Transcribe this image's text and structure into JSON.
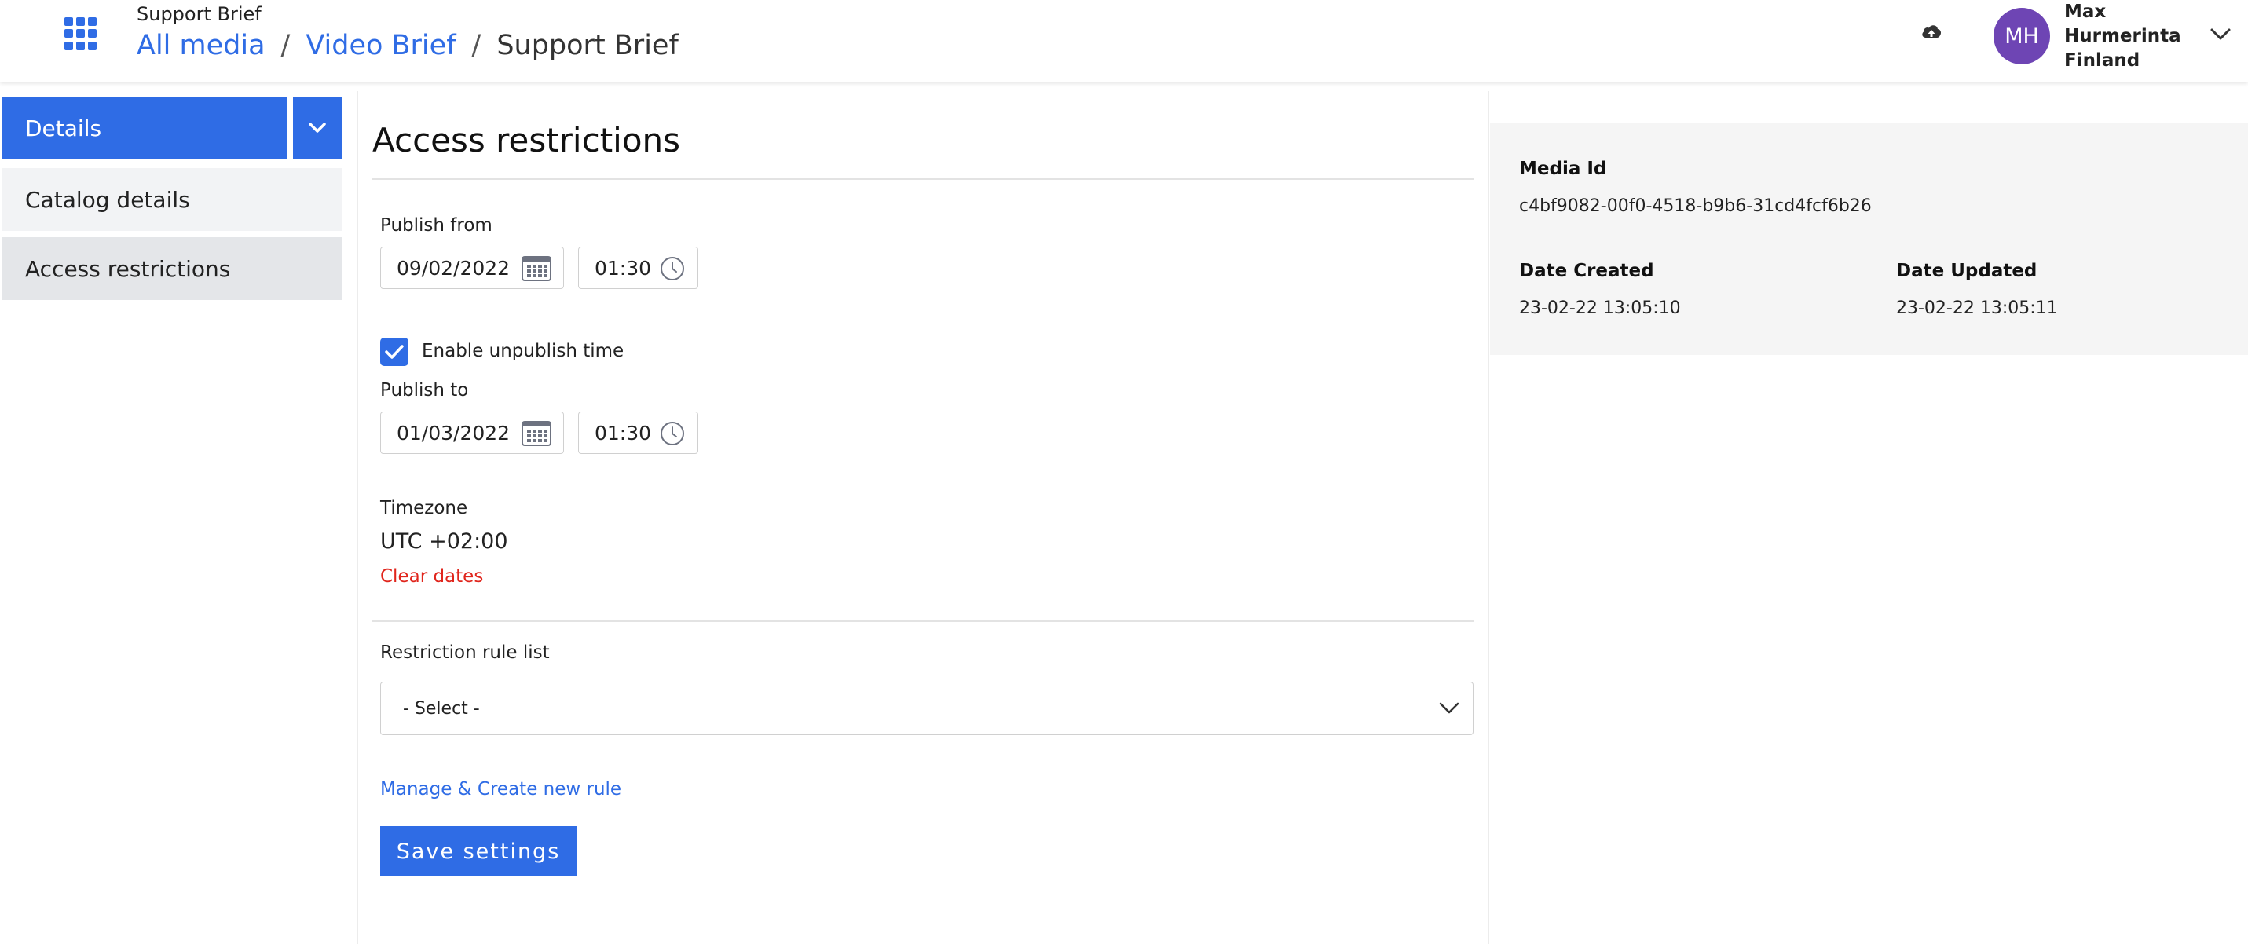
{
  "header": {
    "app_title": "Support Brief",
    "breadcrumb": [
      {
        "label": "All media"
      },
      {
        "label": "Video Brief"
      },
      {
        "label": "Support Brief"
      }
    ],
    "separator": "/",
    "user": {
      "initials": "MH",
      "first_name": "Max",
      "last_name": "Hurmerinta",
      "country": "Finland"
    }
  },
  "sidebar": {
    "active_label": "Details",
    "items": [
      {
        "label": "Catalog details"
      },
      {
        "label": "Access restrictions"
      }
    ]
  },
  "main": {
    "title": "Access restrictions",
    "publish_from": {
      "label": "Publish from",
      "date": "09/02/2022",
      "time": "01:30"
    },
    "enable_unpublish": {
      "label": "Enable unpublish time",
      "checked": true
    },
    "publish_to": {
      "label": "Publish to",
      "date": "01/03/2022",
      "time": "01:30"
    },
    "timezone": {
      "label": "Timezone",
      "value": "UTC +02:00"
    },
    "clear_dates": "Clear dates",
    "restriction": {
      "label": "Restriction rule list",
      "selected": "- Select -"
    },
    "manage_link": "Manage & Create new rule",
    "save_label": "Save settings"
  },
  "info": {
    "media_id_label": "Media Id",
    "media_id": "c4bf9082-00f0-4518-b9b6-31cd4fcf6b26",
    "created_label": "Date Created",
    "created": "23-02-22 13:05:10",
    "updated_label": "Date Updated",
    "updated": "23-02-22 13:05:11"
  },
  "colors": {
    "accent": "#2f6ce5",
    "avatar": "#6e45b4",
    "danger": "#e0251c"
  },
  "icons": [
    "apps-grid-icon",
    "upload-cloud-icon",
    "chevron-down-icon",
    "calendar-icon",
    "clock-icon",
    "checkmark-icon"
  ]
}
